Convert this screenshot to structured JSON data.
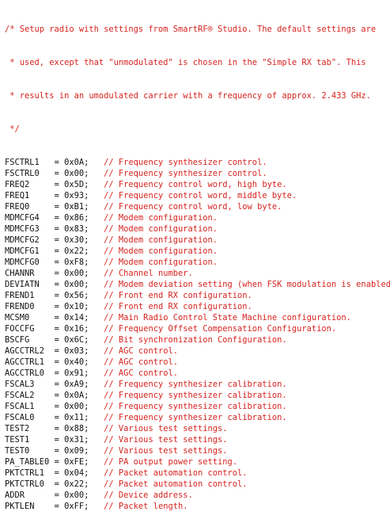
{
  "header_comment": [
    "/* Setup radio with settings from SmartRF® Studio. The default settings are",
    " * used, except that \"unmodulated\" is chosen in the \"Simple RX tab\". This",
    " * results in an umodulated carrier with a frequency of approx. 2.433 GHz.",
    " */"
  ],
  "registers": [
    {
      "name": "FSCTRL1",
      "value": "0x0A",
      "comment": "// Frequency synthesizer control."
    },
    {
      "name": "FSCTRL0",
      "value": "0x00",
      "comment": "// Frequency synthesizer control."
    },
    {
      "name": "FREQ2",
      "value": "0x5D",
      "comment": "// Frequency control word, high byte."
    },
    {
      "name": "FREQ1",
      "value": "0x93",
      "comment": "// Frequency control word, middle byte."
    },
    {
      "name": "FREQ0",
      "value": "0xB1",
      "comment": "// Frequency control word, low byte."
    },
    {
      "name": "MDMCFG4",
      "value": "0x86",
      "comment": "// Modem configuration."
    },
    {
      "name": "MDMCFG3",
      "value": "0x83",
      "comment": "// Modem configuration."
    },
    {
      "name": "MDMCFG2",
      "value": "0x30",
      "comment": "// Modem configuration."
    },
    {
      "name": "MDMCFG1",
      "value": "0x22",
      "comment": "// Modem configuration."
    },
    {
      "name": "MDMCFG0",
      "value": "0xF8",
      "comment": "// Modem configuration."
    },
    {
      "name": "CHANNR",
      "value": "0x00",
      "comment": "// Channel number."
    },
    {
      "name": "DEVIATN",
      "value": "0x00",
      "comment": "// Modem deviation setting (when FSK modulation is enabled)."
    },
    {
      "name": "FREND1",
      "value": "0x56",
      "comment": "// Front end RX configuration."
    },
    {
      "name": "FREND0",
      "value": "0x10",
      "comment": "// Front end RX configuration."
    },
    {
      "name": "MCSM0",
      "value": "0x14",
      "comment": "// Main Radio Control State Machine configuration."
    },
    {
      "name": "FOCCFG",
      "value": "0x16",
      "comment": "// Frequency Offset Compensation Configuration."
    },
    {
      "name": "BSCFG",
      "value": "0x6C",
      "comment": "// Bit synchronization Configuration."
    },
    {
      "name": "AGCCTRL2",
      "value": "0x03",
      "comment": "// AGC control."
    },
    {
      "name": "AGCCTRL1",
      "value": "0x40",
      "comment": "// AGC control."
    },
    {
      "name": "AGCCTRL0",
      "value": "0x91",
      "comment": "// AGC control."
    },
    {
      "name": "FSCAL3",
      "value": "0xA9",
      "comment": "// Frequency synthesizer calibration."
    },
    {
      "name": "FSCAL2",
      "value": "0x0A",
      "comment": "// Frequency synthesizer calibration."
    },
    {
      "name": "FSCAL1",
      "value": "0x00",
      "comment": "// Frequency synthesizer calibration."
    },
    {
      "name": "FSCAL0",
      "value": "0x11",
      "comment": "// Frequency synthesizer calibration."
    },
    {
      "name": "TEST2",
      "value": "0x88",
      "comment": "// Various test settings."
    },
    {
      "name": "TEST1",
      "value": "0x31",
      "comment": "// Various test settings."
    },
    {
      "name": "TEST0",
      "value": "0x09",
      "comment": "// Various test settings."
    },
    {
      "name": "PA_TABLE0",
      "value": "0xFE",
      "comment": "// PA output power setting."
    },
    {
      "name": "PKTCTRL1",
      "value": "0x04",
      "comment": "// Packet automation control."
    },
    {
      "name": "PKTCTRL0",
      "value": "0x22",
      "comment": "// Packet automation control."
    },
    {
      "name": "ADDR",
      "value": "0x00",
      "comment": "// Device address."
    },
    {
      "name": "PKTLEN",
      "value": "0xFF",
      "comment": "// Packet length."
    }
  ],
  "colors": {
    "comment": "#d6231f",
    "code": "#111111",
    "background": "#ffffff"
  }
}
